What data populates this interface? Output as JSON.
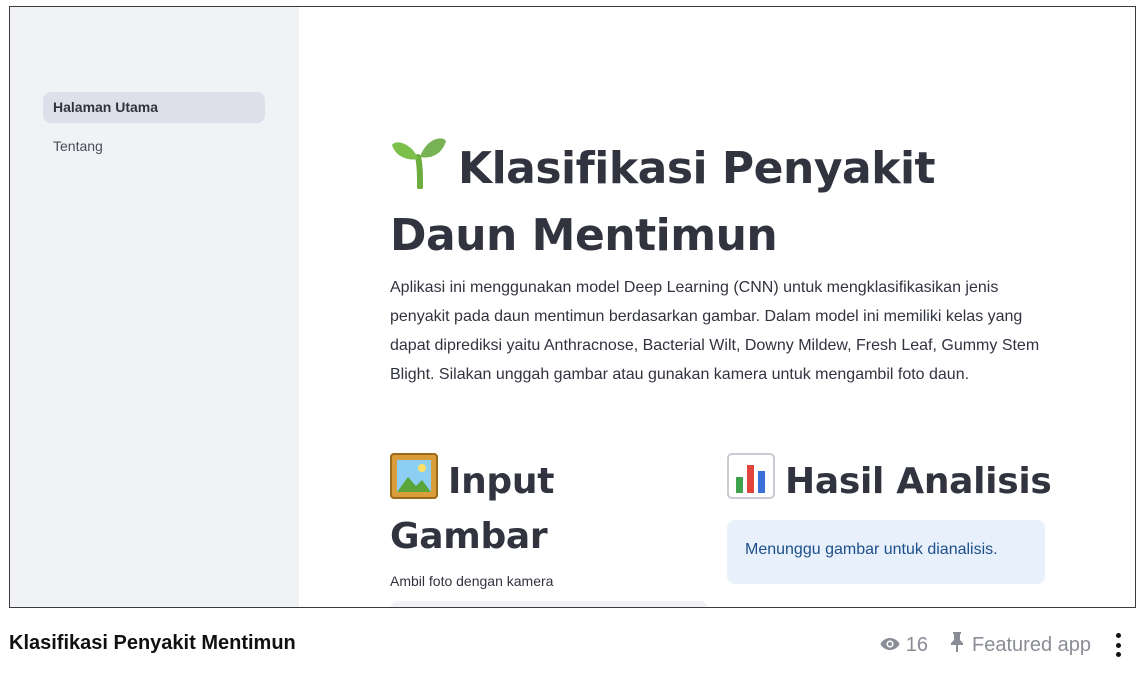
{
  "sidebar": {
    "items": [
      {
        "label": "Halaman Utama",
        "active": true
      },
      {
        "label": "Tentang",
        "active": false
      }
    ]
  },
  "main": {
    "title": "Klasifikasi Penyakit Daun Mentimun",
    "title_icon": "seedling-icon",
    "intro": "Aplikasi ini menggunakan model Deep Learning (CNN) untuk mengklasifikasikan jenis penyakit pada daun mentimun berdasarkan gambar. Dalam model ini memiliki kelas yang dapat diprediksi yaitu Anthracnose, Bacterial Wilt, Downy Mildew, Fresh Leaf, Gummy Stem Blight. Silakan unggah gambar atau gunakan kamera untuk mengambil foto daun.",
    "input_section": {
      "title": "Input Gambar",
      "icon": "framed-picture-icon",
      "camera_label": "Ambil foto dengan kamera"
    },
    "result_section": {
      "title": "Hasil Analisis",
      "icon": "bar-chart-icon",
      "info_message": "Menunggu gambar untuk dianalisis."
    }
  },
  "footer": {
    "app_name": "Klasifikasi Penyakit Mentimun",
    "views": "16",
    "featured_label": "Featured app"
  },
  "colors": {
    "sidebar_bg": "#f0f2f6",
    "active_nav_bg": "#dde0ea",
    "info_bg": "#e7f0fb",
    "info_text": "#1d4f8a"
  }
}
